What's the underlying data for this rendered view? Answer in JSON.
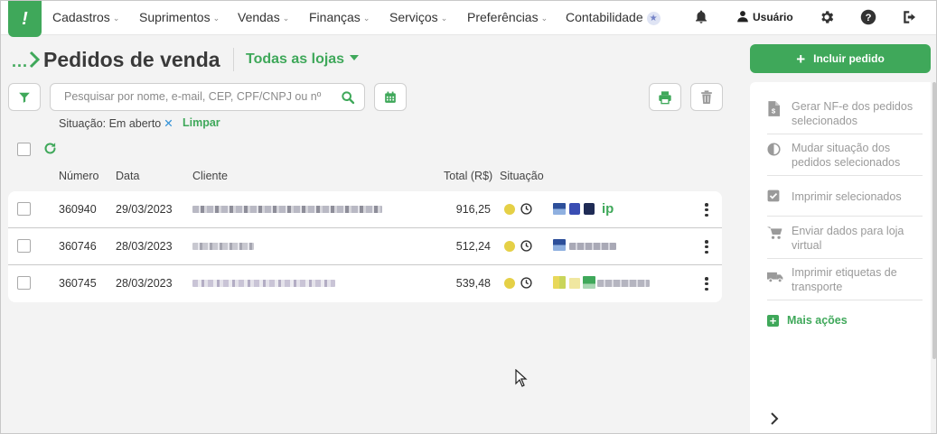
{
  "nav": {
    "logo_glyph": "!",
    "items": [
      "Cadastros",
      "Suprimentos",
      "Vendas",
      "Finanças",
      "Serviços",
      "Preferências",
      "Contabilidade"
    ],
    "user_label": "Usuário"
  },
  "header": {
    "breadcrumb_dots": "...",
    "title": "Pedidos de venda",
    "store_selector": "Todas as lojas"
  },
  "toolbar": {
    "search_placeholder": "Pesquisar por nome, e-mail, CEP, CPF/CNPJ ou nº",
    "search_value": ""
  },
  "filter": {
    "label": "Situação: Em aberto",
    "remove_glyph": "✕",
    "clear_label": "Limpar"
  },
  "table": {
    "columns": [
      "Número",
      "Data",
      "Cliente",
      "Total (R$)",
      "Situação"
    ],
    "rows": [
      {
        "numero": "360940",
        "data": "29/03/2023",
        "total": "916,25",
        "status_color": "#e5d046"
      },
      {
        "numero": "360746",
        "data": "28/03/2023",
        "total": "512,24",
        "status_color": "#e5d046"
      },
      {
        "numero": "360745",
        "data": "28/03/2023",
        "total": "539,48",
        "status_color": "#e5d046"
      }
    ]
  },
  "sidebar": {
    "primary_button": "Incluir pedido",
    "actions": [
      {
        "icon": "document-dollar-icon",
        "label": "Gerar NF-e dos pedidos selecionados"
      },
      {
        "icon": "half-circle-icon",
        "label": "Mudar situação dos pedidos selecionados"
      },
      {
        "icon": "checkbox-checked-icon",
        "label": "Imprimir selecionados"
      },
      {
        "icon": "cart-icon",
        "label": "Enviar dados para loja virtual"
      },
      {
        "icon": "truck-icon",
        "label": "Imprimir etiquetas de transporte"
      }
    ],
    "more_actions": "Mais ações"
  },
  "colors": {
    "brand_green": "#3fa85a",
    "status_open": "#e5d046",
    "accent_blue": "#2b8ed6"
  }
}
